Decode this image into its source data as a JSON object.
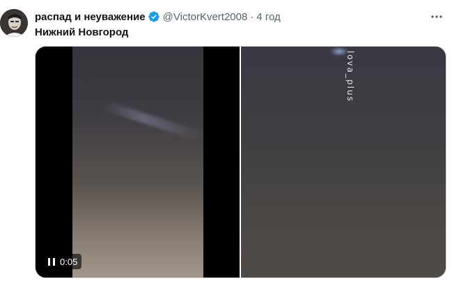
{
  "author": {
    "display_name": "распад и неуважение",
    "handle": "@VictorKvert2008",
    "separator": "·",
    "time": "4 год",
    "verified": true
  },
  "tweet": {
    "text": "Нижний Новгород"
  },
  "media": {
    "video": {
      "elapsed": "0:05",
      "state": "paused-control-shown",
      "watermark": "lova_plus"
    }
  },
  "icons": {
    "more": "more-options-icon",
    "verified": "verified-badge-icon",
    "pause": "pause-icon"
  },
  "colors": {
    "verified": "#1d9bf0",
    "text_primary": "#0f1419",
    "text_secondary": "#536471"
  }
}
